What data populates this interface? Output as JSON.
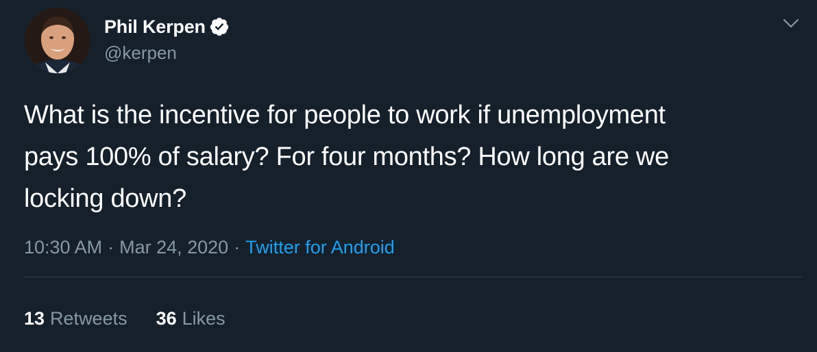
{
  "author": {
    "display_name": "Phil Kerpen",
    "handle": "@kerpen",
    "verified_icon": "verified-badge-icon"
  },
  "tweet": {
    "text": "What is the incentive for people to work if unemployment\npays 100% of salary?  For four months?  How long are we\nlocking down?",
    "time": "10:30 AM",
    "date": "Mar 24, 2020",
    "separator": "·",
    "source": "Twitter for Android"
  },
  "stats": {
    "retweets_count": "13",
    "retweets_label": "Retweets",
    "likes_count": "36",
    "likes_label": "Likes"
  },
  "colors": {
    "background": "#15202b",
    "primary_text": "#ffffff",
    "secondary_text": "#8899a6",
    "link": "#1da1f2",
    "divider": "#38444d"
  }
}
